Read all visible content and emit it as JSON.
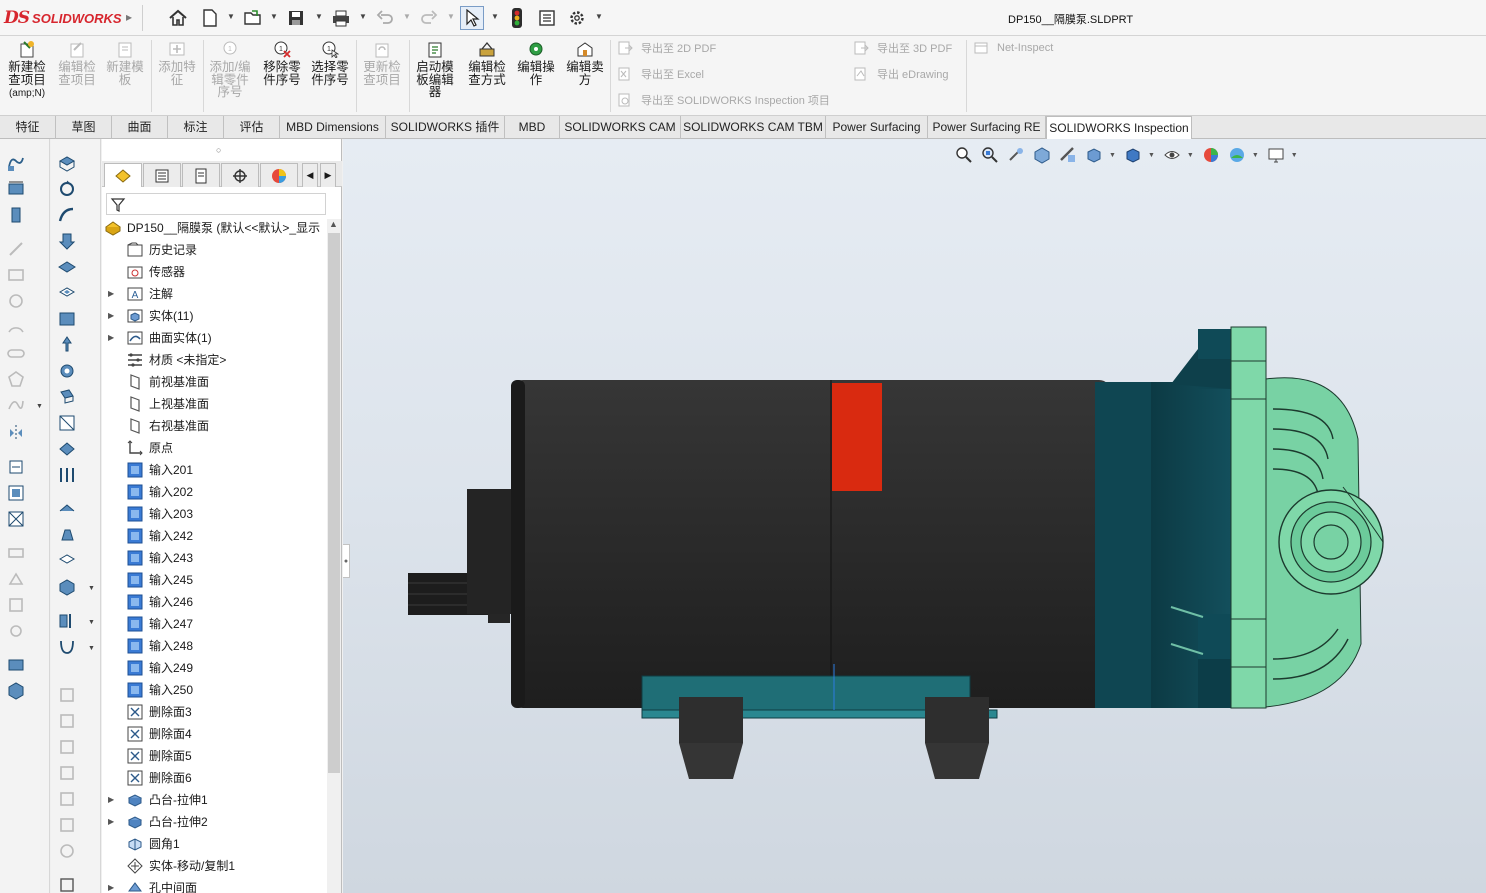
{
  "app": {
    "logo_ds": "DS",
    "logo_text": "SOLIDWORKS",
    "document_title": "DP150__隔膜泵.SLDPRT"
  },
  "quick_access": {
    "icons": [
      "home-icon",
      "new-document-icon",
      "open-icon",
      "save-icon",
      "print-icon",
      "undo-icon",
      "redo-icon",
      "select-icon",
      "rebuild-traffic-light-icon",
      "file-properties-icon",
      "options-gear-icon"
    ]
  },
  "ribbon": {
    "buttons": [
      {
        "label": "新建检查项目",
        "sub": "(amp;N)",
        "enabled": true
      },
      {
        "label": "编辑检查项目",
        "enabled": false
      },
      {
        "label": "新建模板",
        "enabled": false
      },
      {
        "label": "添加特征",
        "enabled": false
      },
      {
        "label": "添加/编辑零件序号",
        "enabled": false
      },
      {
        "label": "移除零件序号",
        "enabled": true
      },
      {
        "label": "选择零件序号",
        "enabled": true
      },
      {
        "label": "更新检查项目",
        "enabled": false
      },
      {
        "label": "启动模板编辑器",
        "enabled": true
      },
      {
        "label": "编辑检查方式",
        "enabled": true
      },
      {
        "label": "编辑操作",
        "enabled": true
      },
      {
        "label": "编辑卖方",
        "enabled": true
      }
    ],
    "export_rows": [
      {
        "label": "导出至 2D PDF"
      },
      {
        "label": "导出至 Excel"
      },
      {
        "label": "导出至 SOLIDWORKS Inspection 项目"
      },
      {
        "label": "导出至 3D PDF"
      },
      {
        "label": "导出 eDrawing"
      },
      {
        "label": "Net-Inspect"
      }
    ]
  },
  "tabs": [
    {
      "label": "特征"
    },
    {
      "label": "草图"
    },
    {
      "label": "曲面"
    },
    {
      "label": "标注"
    },
    {
      "label": "评估"
    },
    {
      "label": "MBD Dimensions"
    },
    {
      "label": "SOLIDWORKS 插件"
    },
    {
      "label": "MBD"
    },
    {
      "label": "SOLIDWORKS CAM"
    },
    {
      "label": "SOLIDWORKS CAM TBM"
    },
    {
      "label": "Power Surfacing"
    },
    {
      "label": "Power Surfacing RE"
    },
    {
      "label": "SOLIDWORKS Inspection"
    }
  ],
  "feature_tree": {
    "root": "DP150__隔膜泵  (默认<<默认>_显示",
    "items": [
      {
        "label": "历史记录",
        "icon": "history-folder-icon",
        "expandable": false
      },
      {
        "label": "传感器",
        "icon": "sensor-icon",
        "expandable": false
      },
      {
        "label": "注解",
        "icon": "annotation-icon",
        "expandable": true
      },
      {
        "label": "实体(11)",
        "icon": "solid-bodies-icon",
        "expandable": true
      },
      {
        "label": "曲面实体(1)",
        "icon": "surface-bodies-icon",
        "expandable": true
      },
      {
        "label": "材质 <未指定>",
        "icon": "material-icon",
        "expandable": false
      },
      {
        "label": "前视基准面",
        "icon": "plane-icon",
        "expandable": false
      },
      {
        "label": "上视基准面",
        "icon": "plane-icon",
        "expandable": false
      },
      {
        "label": "右视基准面",
        "icon": "plane-icon",
        "expandable": false
      },
      {
        "label": "原点",
        "icon": "origin-icon",
        "expandable": false
      },
      {
        "label": "输入201",
        "icon": "imported-body-icon",
        "expandable": false
      },
      {
        "label": "输入202",
        "icon": "imported-body-icon",
        "expandable": false
      },
      {
        "label": "输入203",
        "icon": "imported-body-icon",
        "expandable": false
      },
      {
        "label": "输入242",
        "icon": "imported-body-icon",
        "expandable": false
      },
      {
        "label": "输入243",
        "icon": "imported-body-icon",
        "expandable": false
      },
      {
        "label": "输入245",
        "icon": "imported-body-icon",
        "expandable": false
      },
      {
        "label": "输入246",
        "icon": "imported-body-icon",
        "expandable": false
      },
      {
        "label": "输入247",
        "icon": "imported-body-icon",
        "expandable": false
      },
      {
        "label": "输入248",
        "icon": "imported-body-icon",
        "expandable": false
      },
      {
        "label": "输入249",
        "icon": "imported-body-icon",
        "expandable": false
      },
      {
        "label": "输入250",
        "icon": "imported-body-icon",
        "expandable": false
      },
      {
        "label": "删除面3",
        "icon": "delete-face-icon",
        "expandable": false
      },
      {
        "label": "删除面4",
        "icon": "delete-face-icon",
        "expandable": false
      },
      {
        "label": "删除面5",
        "icon": "delete-face-icon",
        "expandable": false
      },
      {
        "label": "删除面6",
        "icon": "delete-face-icon",
        "expandable": false
      },
      {
        "label": "凸台-拉伸1",
        "icon": "boss-extrude-icon",
        "expandable": true
      },
      {
        "label": "凸台-拉伸2",
        "icon": "boss-extrude-icon",
        "expandable": true
      },
      {
        "label": "圆角1",
        "icon": "fillet-icon",
        "expandable": false
      },
      {
        "label": "实体-移动/复制1",
        "icon": "move-copy-body-icon",
        "expandable": false
      },
      {
        "label": "孔中间面",
        "icon": "mid-surface-icon",
        "expandable": true
      }
    ]
  },
  "colors": {
    "motor_body": "#2b2b2b",
    "label_red": "#d92a10",
    "teal_dark": "#0e4550",
    "mint_green": "#78d2a4",
    "brand_red": "#d7262e"
  }
}
